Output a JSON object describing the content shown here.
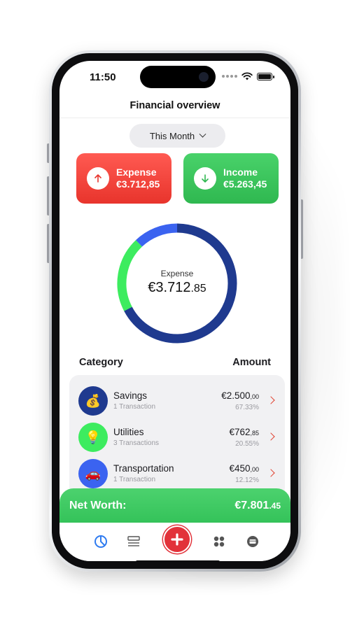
{
  "status_bar": {
    "time": "11:50"
  },
  "header": {
    "title": "Financial overview"
  },
  "period_selector": {
    "label": "This Month"
  },
  "summary_cards": {
    "expense": {
      "label": "Expense",
      "amount": "€3.712,85",
      "color": "#e8342c"
    },
    "income": {
      "label": "Income",
      "amount": "€5.263,45",
      "color": "#2fb850"
    }
  },
  "donut": {
    "label": "Expense",
    "value_main": "€3.712",
    "value_dec": ".85",
    "segments": [
      {
        "category": "Savings",
        "percent": 67.33,
        "color": "#1f3a8f"
      },
      {
        "category": "Utilities",
        "percent": 20.55,
        "color": "#3dec5f"
      },
      {
        "category": "Transportation",
        "percent": 12.12,
        "color": "#3b63f0"
      }
    ]
  },
  "list_header": {
    "category": "Category",
    "amount": "Amount"
  },
  "categories": [
    {
      "name": "Savings",
      "sub": "1 Transaction",
      "amount_main": "€2.500",
      "amount_dec": ",00",
      "percent": "67.33%",
      "icon": "money-bag-icon",
      "color": "#1f3a8f"
    },
    {
      "name": "Utilities",
      "sub": "3 Transactions",
      "amount_main": "€762",
      "amount_dec": ",85",
      "percent": "20.55%",
      "icon": "lightbulb-icon",
      "color": "#3dec5f"
    },
    {
      "name": "Transportation",
      "sub": "1 Transaction",
      "amount_main": "€450",
      "amount_dec": ",00",
      "percent": "12.12%",
      "icon": "car-icon",
      "color": "#3b63f0"
    }
  ],
  "net_worth": {
    "label": "Net Worth:",
    "value_main": "€7.801",
    "value_dec": ".45"
  },
  "tabbar": {
    "tabs": [
      "pie-chart-icon",
      "list-icon",
      "add-icon",
      "grid-icon",
      "wallet-icon"
    ],
    "active_color": "#2f7bf0",
    "accent": "#e2323a"
  }
}
